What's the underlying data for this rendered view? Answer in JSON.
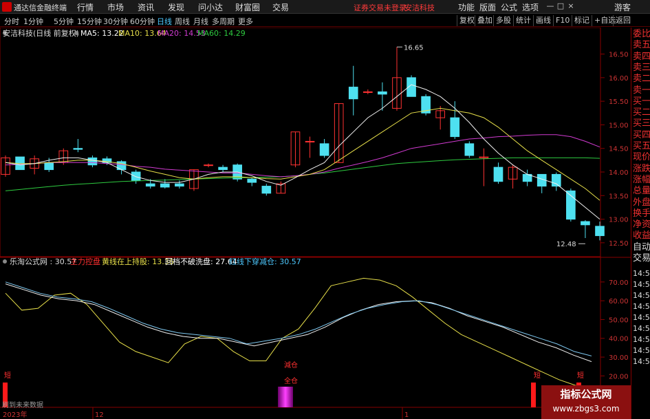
{
  "titlebar": {
    "app_name": "通达信金融终端",
    "menus": [
      "行情",
      "市场",
      "资讯",
      "发现",
      "问小达",
      "财富圈",
      "交易"
    ],
    "notice": [
      "证券交易未登录",
      "安洁科技"
    ],
    "right_menus": [
      "功能",
      "版面",
      "公式",
      "选项"
    ],
    "guest": "游客",
    "window_buttons": {
      "minimize": "—",
      "maximize": "□",
      "close": "×"
    }
  },
  "tabs": {
    "periods": [
      "分时",
      "1分钟",
      "5分钟",
      "15分钟",
      "30分钟",
      "60分钟",
      "日线",
      "周线",
      "月线",
      "多周期",
      "更多"
    ],
    "active": "日线",
    "right_buttons": [
      "复权",
      "叠加",
      "多股",
      "统计",
      "画线",
      "F10",
      "标记",
      "+自选",
      "返回"
    ]
  },
  "right_panel": {
    "items": [
      "委比",
      "卖五",
      "卖四",
      "卖三",
      "卖二",
      "卖一",
      "买一",
      "买二",
      "买三",
      "买四",
      "买五",
      "现价",
      "涨跌",
      "涨幅",
      "总量",
      "外盘",
      "换手",
      "净资",
      "收益",
      "自动",
      "交易"
    ],
    "times": [
      "14:56",
      "14:56",
      "14:56",
      "14:56",
      "14:56",
      "14:56",
      "14:56",
      "14:56",
      "14:56"
    ]
  },
  "main_panel": {
    "title": "安洁科技(日线 前复权)",
    "ma_legend": [
      {
        "label": "MA5: 13.22",
        "color": "#ffffff"
      },
      {
        "label": "MA10: 13.64",
        "color": "#e8e04a"
      },
      {
        "label": "MA20: 14.53",
        "color": "#d23bd2"
      },
      {
        "label": "MA60: 14.29",
        "color": "#2ecc40"
      }
    ],
    "y_ticks": [
      "16.50",
      "16.00",
      "15.50",
      "15.00",
      "14.50",
      "14.00",
      "13.50",
      "13.00",
      "12.50"
    ],
    "high_label": "16.65",
    "low_label": "12.48"
  },
  "indicator_panel": {
    "title": "乐淘公式网 : 30.57",
    "legend": [
      {
        "label": "主力控盘",
        "color": "#ff3030"
      },
      {
        "label": "黄线在上持股: 13.36",
        "color": "#e8e04a"
      },
      {
        "label": "回档不破洗盘: 27.64",
        "color": "#ffffff"
      },
      {
        "label": "红线下穿减仓: 30.57",
        "color": "#4ec9ff"
      }
    ],
    "y_ticks": [
      "70.00",
      "60.00",
      "50.00",
      "40.00",
      "30.00",
      "20.00"
    ],
    "signals": {
      "reduce": "減仓",
      "full": "全仓",
      "short": "短"
    },
    "future_note": "刷到未来数据"
  },
  "x_axis": {
    "labels": [
      "2023年",
      "12",
      "1"
    ]
  },
  "watermark": {
    "title": "指标公式网",
    "url": "www.zbgs3.com"
  },
  "chart_data": {
    "type": "candlestick",
    "ylim": [
      12.25,
      16.8
    ],
    "candles": [
      [
        13.95,
        14.35,
        13.9,
        14.3
      ],
      [
        14.32,
        14.28,
        14.05,
        14.05
      ],
      [
        14.08,
        14.35,
        13.95,
        14.28
      ],
      [
        14.2,
        14.3,
        14.0,
        14.05
      ],
      [
        14.2,
        14.5,
        14.15,
        14.45
      ],
      [
        14.5,
        14.7,
        14.42,
        14.48
      ],
      [
        14.3,
        14.35,
        14.1,
        14.15
      ],
      [
        14.28,
        14.33,
        14.15,
        14.2
      ],
      [
        14.22,
        14.25,
        13.95,
        14.05
      ],
      [
        14.0,
        14.05,
        13.75,
        13.82
      ],
      [
        13.75,
        13.85,
        13.65,
        13.7
      ],
      [
        13.75,
        13.85,
        13.65,
        13.68
      ],
      [
        13.75,
        13.82,
        13.65,
        13.7
      ],
      [
        13.65,
        14.05,
        13.6,
        14.05
      ],
      [
        14.15,
        14.18,
        14.1,
        14.15
      ],
      [
        14.1,
        14.15,
        14.0,
        14.05
      ],
      [
        14.15,
        14.18,
        13.8,
        13.85
      ],
      [
        13.85,
        13.88,
        13.7,
        13.78
      ],
      [
        13.7,
        13.75,
        13.5,
        13.55
      ],
      [
        13.55,
        13.8,
        13.55,
        13.75
      ],
      [
        14.15,
        14.85,
        14.1,
        14.85
      ],
      [
        14.65,
        14.75,
        14.3,
        14.65
      ],
      [
        14.6,
        14.7,
        14.3,
        14.35
      ],
      [
        14.2,
        14.3,
        15.5,
        15.45
      ],
      [
        15.8,
        16.25,
        15.2,
        15.55
      ],
      [
        15.7,
        15.75,
        15.65,
        15.7
      ],
      [
        15.7,
        15.9,
        15.3,
        15.65
      ],
      [
        15.35,
        16.65,
        15.3,
        16.0
      ],
      [
        16.0,
        16.05,
        15.65,
        15.6
      ],
      [
        15.6,
        15.65,
        15.2,
        15.25
      ],
      [
        15.15,
        15.4,
        14.9,
        15.3
      ],
      [
        15.15,
        15.5,
        14.7,
        14.75
      ],
      [
        14.6,
        14.65,
        14.3,
        14.35
      ],
      [
        14.3,
        14.5,
        13.7,
        14.32
      ],
      [
        14.1,
        14.2,
        13.75,
        13.8
      ],
      [
        13.85,
        14.15,
        13.65,
        14.1
      ],
      [
        13.95,
        14.05,
        13.7,
        13.8
      ],
      [
        13.95,
        13.95,
        13.55,
        13.7
      ],
      [
        13.95,
        13.99,
        13.6,
        13.7
      ],
      [
        13.6,
        13.65,
        12.95,
        13.0
      ],
      [
        12.95,
        12.98,
        12.6,
        12.88
      ],
      [
        12.85,
        12.95,
        12.55,
        12.65
      ]
    ],
    "ma5": [
      14.2,
      14.15,
      14.18,
      14.25,
      14.3,
      14.3,
      14.25,
      14.2,
      14.05,
      13.9,
      13.82,
      13.78,
      13.78,
      13.85,
      13.95,
      14.0,
      14.0,
      13.92,
      13.8,
      13.72,
      13.88,
      14.05,
      14.2,
      14.55,
      14.85,
      15.15,
      15.35,
      15.6,
      15.85,
      15.75,
      15.6,
      15.35,
      15.05,
      14.7,
      14.4,
      14.15,
      13.95,
      13.85,
      13.75,
      13.5,
      13.25,
      13.0
    ],
    "ma10": [
      14.2,
      14.18,
      14.18,
      14.2,
      14.22,
      14.25,
      14.25,
      14.22,
      14.18,
      14.1,
      14.02,
      13.95,
      13.88,
      13.85,
      13.88,
      13.9,
      13.9,
      13.88,
      13.86,
      13.85,
      13.9,
      13.95,
      14.05,
      14.25,
      14.45,
      14.65,
      14.85,
      15.05,
      15.25,
      15.3,
      15.35,
      15.3,
      15.25,
      15.15,
      14.95,
      14.7,
      14.45,
      14.25,
      14.05,
      13.85,
      13.65,
      13.4
    ],
    "ma20": [
      14.15,
      14.16,
      14.18,
      14.2,
      14.2,
      14.2,
      14.2,
      14.18,
      14.16,
      14.12,
      14.1,
      14.06,
      14.04,
      14.02,
      14.0,
      13.98,
      13.98,
      13.95,
      13.92,
      13.9,
      13.92,
      13.95,
      14.0,
      14.08,
      14.15,
      14.22,
      14.3,
      14.4,
      14.5,
      14.55,
      14.6,
      14.65,
      14.7,
      14.72,
      14.75,
      14.76,
      14.78,
      14.79,
      14.79,
      14.75,
      14.65,
      14.53
    ],
    "ma60": [
      13.6,
      13.63,
      13.66,
      13.69,
      13.72,
      13.74,
      13.76,
      13.78,
      13.8,
      13.81,
      13.82,
      13.83,
      13.84,
      13.85,
      13.86,
      13.87,
      13.88,
      13.88,
      13.89,
      13.9,
      13.92,
      13.95,
      13.98,
      14.02,
      14.06,
      14.1,
      14.14,
      14.18,
      14.2,
      14.22,
      14.24,
      14.26,
      14.27,
      14.28,
      14.29,
      14.3,
      14.3,
      14.3,
      14.3,
      14.3,
      14.3,
      14.29
    ],
    "indicator": {
      "ylim": [
        15,
        78
      ],
      "yellow": [
        64,
        55,
        56,
        63,
        64,
        58,
        48,
        38,
        33,
        30,
        27,
        37,
        41,
        40,
        33,
        28,
        28,
        40,
        45,
        56,
        68,
        70,
        72,
        71,
        68,
        62,
        55,
        48,
        42,
        38,
        34,
        30,
        26,
        22,
        18,
        15,
        13.4
      ],
      "white": [
        69,
        66,
        63,
        61,
        60,
        58,
        54,
        50,
        46,
        43,
        41,
        40,
        40,
        38,
        36,
        38,
        40,
        42,
        46,
        51,
        55,
        58,
        59.5,
        60,
        59,
        56,
        52,
        49,
        46,
        42,
        38,
        35,
        31,
        27.6
      ],
      "blue": [
        70,
        67,
        64,
        62,
        61,
        59.5,
        56,
        52,
        48,
        45,
        43,
        42,
        41,
        40,
        37,
        38.5,
        40,
        42,
        45,
        49,
        53,
        56,
        58,
        59.5,
        60,
        58,
        55,
        52,
        49,
        46,
        43,
        40,
        37,
        33,
        30.6
      ]
    }
  }
}
